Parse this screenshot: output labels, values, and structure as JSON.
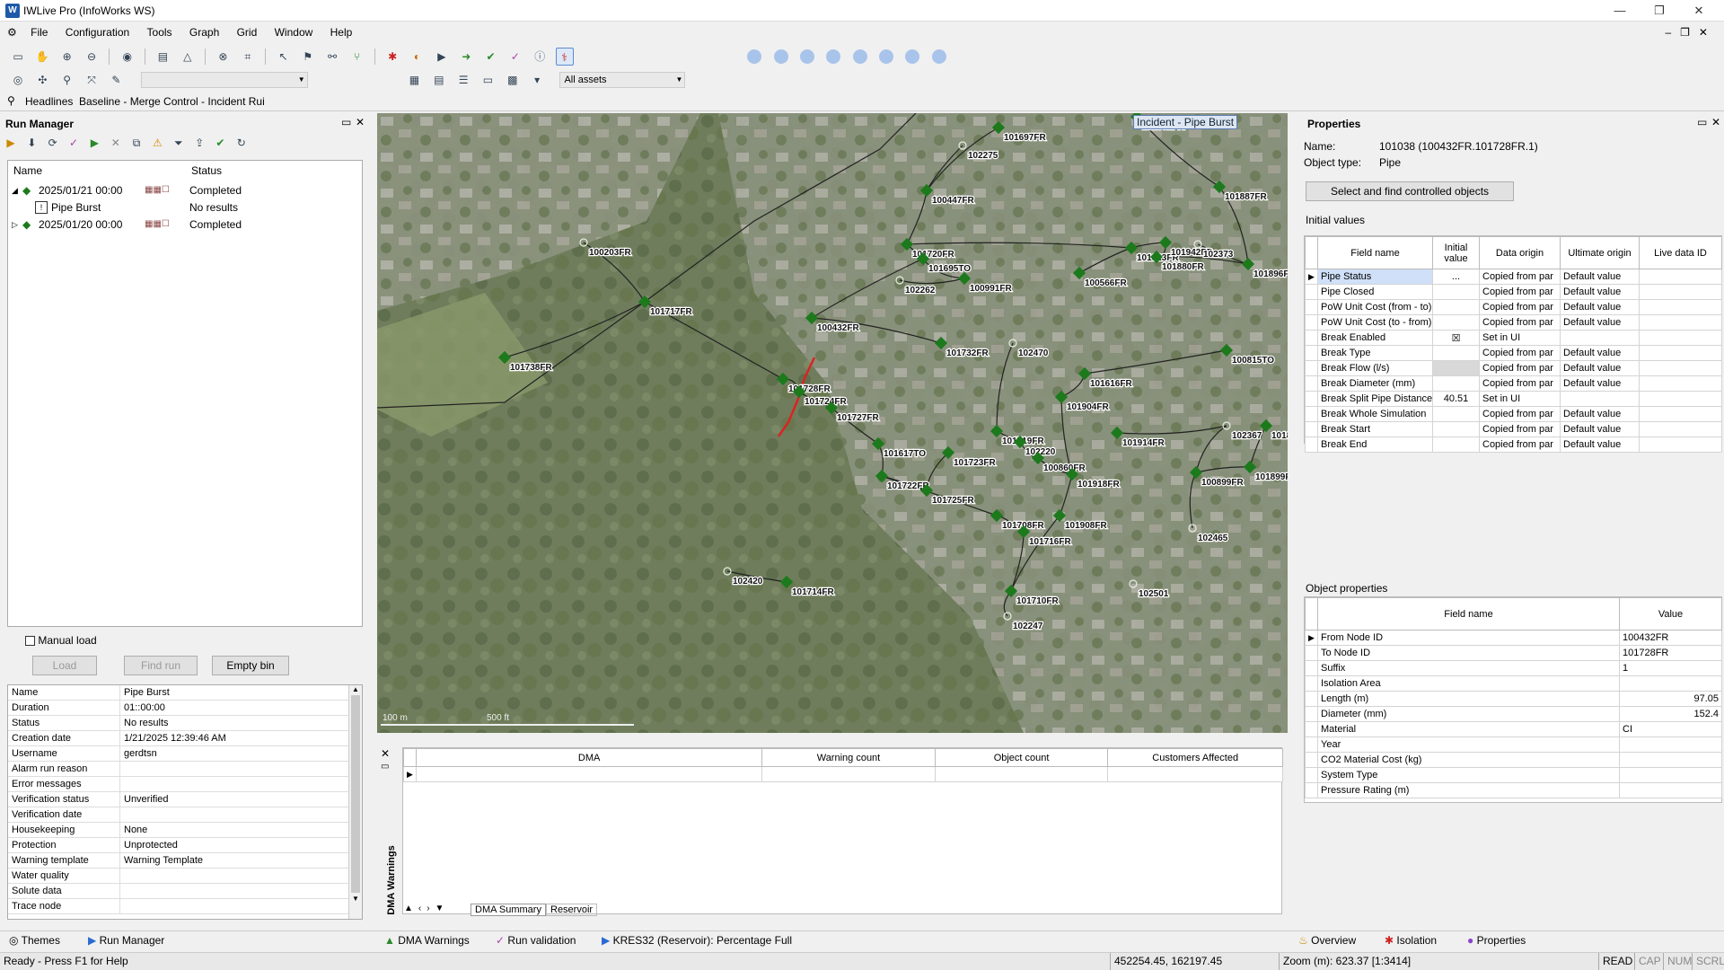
{
  "app": {
    "title": "IWLive Pro (InfoWorks WS)",
    "icon": "app-logo-icon"
  },
  "menu": [
    "File",
    "Configuration",
    "Tools",
    "Graph",
    "Grid",
    "Window",
    "Help"
  ],
  "toolbar": {
    "assets_combo": "All assets"
  },
  "tabs": {
    "headlines": "Headlines",
    "baseline": "Baseline - Merge Control - Incident Rui"
  },
  "run_manager": {
    "title": "Run Manager",
    "col_name": "Name",
    "col_status": "Status",
    "rows": [
      {
        "name": "2025/01/21 00:00",
        "status": "Completed"
      },
      {
        "name": "Pipe Burst",
        "status": "No results"
      },
      {
        "name": "2025/01/20 00:00",
        "status": "Completed"
      }
    ],
    "manual_load": "Manual load",
    "load": "Load",
    "find_run": "Find run",
    "empty_bin": "Empty bin",
    "props": [
      {
        "k": "Name",
        "v": "Pipe Burst"
      },
      {
        "k": "Duration",
        "v": "01::00:00"
      },
      {
        "k": "Status",
        "v": "No results"
      },
      {
        "k": "Creation date",
        "v": "1/21/2025 12:39:46 AM"
      },
      {
        "k": "Username",
        "v": "gerdtsn"
      },
      {
        "k": "Alarm run reason",
        "v": ""
      },
      {
        "k": "Error messages",
        "v": ""
      },
      {
        "k": "Verification status",
        "v": "Unverified"
      },
      {
        "k": "Verification date",
        "v": ""
      },
      {
        "k": "Housekeeping",
        "v": "None"
      },
      {
        "k": "Protection",
        "v": "Unprotected"
      },
      {
        "k": "Warning template",
        "v": "Warning Template"
      },
      {
        "k": "Water quality",
        "v": ""
      },
      {
        "k": "Solute data",
        "v": ""
      },
      {
        "k": "Trace node",
        "v": ""
      }
    ]
  },
  "map": {
    "incident_label": "Incident - Pipe Burst",
    "scale_100": "100 m",
    "scale_500": "500 ft",
    "nodes": [
      "101697FR",
      "101892FR",
      "102275",
      "101887FR",
      "100447FR",
      "100203FR",
      "101720FR",
      "101695TO",
      "101923FR",
      "101942FR",
      "102373",
      "101880FR",
      "101896F",
      "101717FR",
      "102262",
      "100991FR",
      "100566FR",
      "100432FR",
      "101738FR",
      "101732FR",
      "102470",
      "100815TO",
      "101728FR",
      "101724FR",
      "101727FR",
      "101616FR",
      "101904FR",
      "101719FR",
      "102220",
      "101914FR",
      "102367",
      "101898",
      "101617TO",
      "101723FR",
      "100860FR",
      "101722FR",
      "101725FR",
      "101918FR",
      "100899FR",
      "101899F",
      "101708FR",
      "101908FR",
      "101716FR",
      "102465",
      "102420",
      "101714FR",
      "101710FR",
      "102501",
      "102247"
    ]
  },
  "dma": {
    "side_label": "DMA Warnings",
    "columns": [
      "DMA",
      "Warning count",
      "Object count",
      "Customers Affected"
    ],
    "tabs": [
      "DMA Summary",
      "Reservoir"
    ]
  },
  "properties": {
    "title": "Properties",
    "name_label": "Name:",
    "name_value": "101038 (100432FR.101728FR.1)",
    "type_label": "Object type:",
    "type_value": "Pipe",
    "select_button": "Select and find controlled objects",
    "initial_values": "Initial values",
    "iv_columns": [
      "Field name",
      "Initial value",
      "Data origin",
      "Ultimate origin",
      "Live data ID"
    ],
    "iv_rows": [
      {
        "f": "Pipe Status",
        "v": "...",
        "d": "Copied from par",
        "u": "Default value"
      },
      {
        "f": "Pipe Closed",
        "v": "",
        "d": "Copied from par",
        "u": "Default value"
      },
      {
        "f": "PoW Unit Cost (from - to)",
        "v": "",
        "d": "Copied from par",
        "u": "Default value"
      },
      {
        "f": "PoW Unit Cost (to - from)",
        "v": "",
        "d": "Copied from par",
        "u": "Default value"
      },
      {
        "f": "Break Enabled",
        "v": "☒",
        "d": "Set in UI",
        "u": ""
      },
      {
        "f": "Break Type",
        "v": "",
        "d": "Copied from par",
        "u": "Default value"
      },
      {
        "f": "Break Flow (l/s)",
        "v": "",
        "d": "Copied from par",
        "u": "Default value"
      },
      {
        "f": "Break Diameter (mm)",
        "v": "",
        "d": "Copied from par",
        "u": "Default value"
      },
      {
        "f": "Break Split Pipe Distance",
        "v": "40.51",
        "d": "Set in UI",
        "u": ""
      },
      {
        "f": "Break Whole Simulation",
        "v": "",
        "d": "Copied from par",
        "u": "Default value"
      },
      {
        "f": "Break Start",
        "v": "",
        "d": "Copied from par",
        "u": "Default value"
      },
      {
        "f": "Break End",
        "v": "",
        "d": "Copied from par",
        "u": "Default value"
      }
    ],
    "object_properties": "Object properties",
    "op_columns": [
      "Field name",
      "Value"
    ],
    "op_rows": [
      {
        "f": "From Node ID",
        "v": "100432FR"
      },
      {
        "f": "To Node ID",
        "v": "101728FR"
      },
      {
        "f": "Suffix",
        "v": "1"
      },
      {
        "f": "Isolation Area",
        "v": ""
      },
      {
        "f": "Length (m)",
        "v": "97.05"
      },
      {
        "f": "Diameter (mm)",
        "v": "152.4"
      },
      {
        "f": "Material",
        "v": "CI"
      },
      {
        "f": "Year",
        "v": ""
      },
      {
        "f": "CO2 Material Cost (kg)",
        "v": ""
      },
      {
        "f": "System Type",
        "v": ""
      },
      {
        "f": "Pressure Rating (m)",
        "v": ""
      }
    ]
  },
  "bottom_tabs": {
    "themes": "Themes",
    "run_manager": "Run Manager",
    "dma_warnings": "DMA Warnings",
    "run_validation": "Run validation",
    "kres": "KRES32 (Reservoir): Percentage Full",
    "overview": "Overview",
    "isolation": "Isolation",
    "properties": "Properties"
  },
  "status": {
    "help": "Ready - Press F1 for Help",
    "coords": "452254.45, 162197.45",
    "zoom": "Zoom (m): 623.37 [1:3414]",
    "read": "READ",
    "cap": "CAP",
    "num": "NUM",
    "scrl": "SCRL"
  },
  "colors": {
    "node": "#1c7a1c",
    "burst_pipe": "#e02020",
    "selection": "#cfe0f8"
  }
}
